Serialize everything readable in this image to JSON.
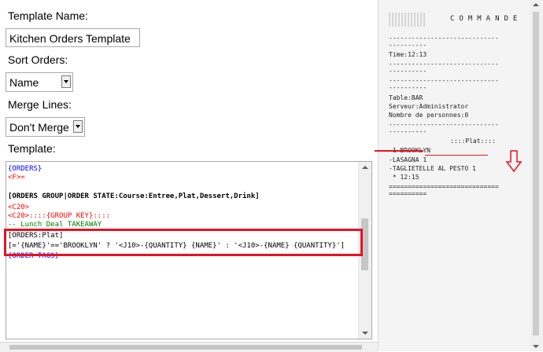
{
  "form": {
    "template_name_label": "Template Name:",
    "template_name_value": "Kitchen Orders Template",
    "sort_orders_label": "Sort Orders:",
    "sort_orders_value": "Name",
    "merge_lines_label": "Merge Lines:",
    "merge_lines_value": "Don't Merge",
    "template_label": "Template:"
  },
  "editor": {
    "lines": [
      {
        "text": "{ORDERS}",
        "color": "#0000ff"
      },
      {
        "text": "<F>=",
        "color": "#ff0000"
      },
      {
        "text": "",
        "color": "#000000"
      },
      {
        "text": "[ORDERS GROUP|ORDER STATE:Course:Entree,Plat,Dessert,Drink]",
        "color": "#000000"
      },
      {
        "text": "<C20>",
        "color": "#ff0000"
      },
      {
        "text": "<C20>::::{GROUP KEY}::::",
        "color": "#ff0000"
      },
      {
        "text": "-- Lunch Deal TAKEAWAY",
        "color": "#008000"
      },
      {
        "text": "[ORDERS:Plat]",
        "color": "#000000"
      },
      {
        "text": "[='{NAME}'=='BROOKLYN' ? '<J10>-{QUANTITY} {NAME}' : '<J10>-{NAME} {QUANTITY}']",
        "color": "#000000"
      },
      {
        "text": "{ORDER TAGS}",
        "color": "#0000ff"
      }
    ]
  },
  "preview": {
    "header": "COMMANDE",
    "dashes": "-----------------------------",
    "dashes_short": "----------",
    "time": "Time:12:13",
    "table": "Table:BAR",
    "server": "Serveur:Administrator",
    "persons": "Nombre de personnes:0",
    "group": "::::Plat::::",
    "item1": "-1 BROOKLYN",
    "item2": "-LASAGNA 1",
    "item3": "-TAGLIETELLE AL PESTO 1",
    "item4": " * 12:15",
    "equals": "=============================",
    "equals_short": "=========="
  },
  "colors": {
    "highlight": "#e81123",
    "keyword_blue": "#0000ff",
    "tag_red": "#ff0000",
    "comment_green": "#008000"
  }
}
